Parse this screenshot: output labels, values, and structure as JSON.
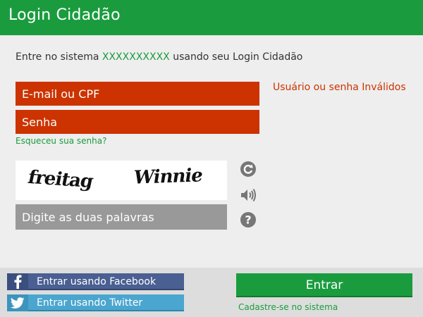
{
  "header": {
    "title": "Login Cidadão"
  },
  "intro": {
    "prefix": "Entre no sistema ",
    "system_name": "XXXXXXXXXX",
    "suffix": " usando seu Login Cidadão"
  },
  "form": {
    "email_placeholder": "E-mail ou CPF",
    "password_placeholder": "Senha",
    "error_message": "Usuário ou senha Inválidos",
    "forgot_link": "Esqueceu sua senha?"
  },
  "captcha": {
    "words": [
      "freitag",
      "Winnie"
    ],
    "input_placeholder": "Digite as duas palavras",
    "icons": [
      "refresh-icon",
      "audio-icon",
      "help-icon"
    ]
  },
  "footer": {
    "facebook_label": "Entrar usando Facebook",
    "twitter_label": "Entrar usando Twitter",
    "login_button": "Entrar",
    "register_link": "Cadastre-se no sistema"
  },
  "colors": {
    "brand_green": "#1a9c3e",
    "error_red": "#cc3300",
    "facebook_blue": "#4a5f92",
    "twitter_blue": "#4aa6cf",
    "captcha_gray": "#999999"
  }
}
